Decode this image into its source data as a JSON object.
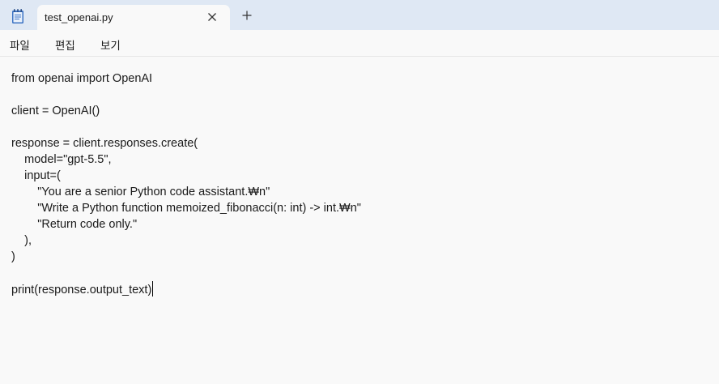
{
  "tab": {
    "title": "test_openai.py"
  },
  "menu": {
    "items": [
      {
        "label": "파일"
      },
      {
        "label": "편집"
      },
      {
        "label": "보기"
      }
    ]
  },
  "editor": {
    "lines": [
      "from openai import OpenAI",
      "",
      "client = OpenAI()",
      "",
      "response = client.responses.create(",
      "    model=\"gpt-5.5\",",
      "    input=(",
      "        \"You are a senior Python code assistant.₩n\"",
      "        \"Write a Python function memoized_fibonacci(n: int) -> int.₩n\"",
      "        \"Return code only.\"",
      "    ),",
      ")",
      "",
      "print(response.output_text)"
    ]
  },
  "icons": {
    "app": "notepad-icon",
    "close": "close-icon",
    "new_tab": "plus-icon"
  },
  "colors": {
    "tabstrip": "#dfe8f4",
    "background": "#f9f9f9",
    "text": "#1a1a1a"
  }
}
